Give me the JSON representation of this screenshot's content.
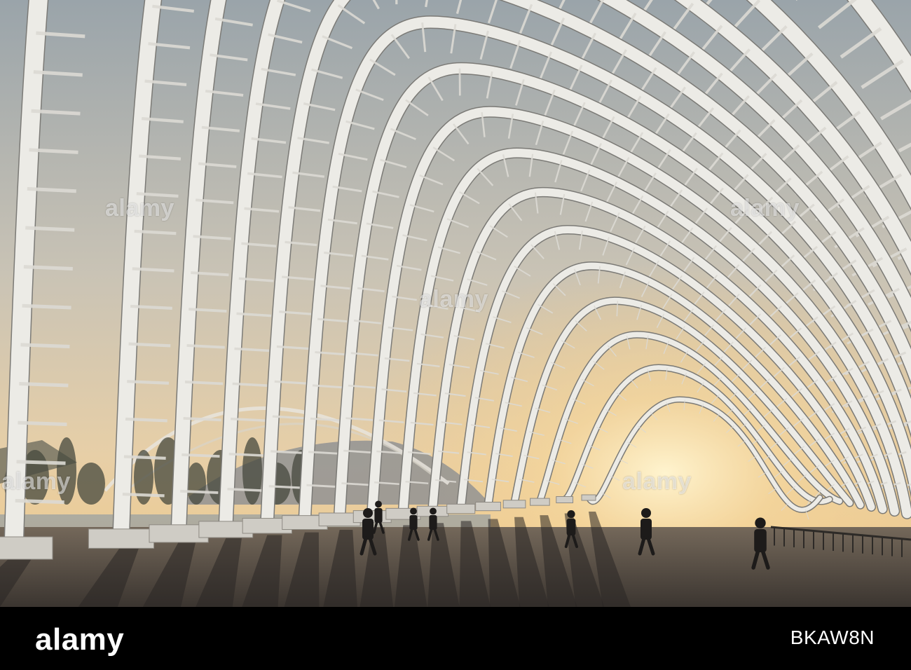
{
  "photo": {
    "subject": "silhouettes walking under white steel arches at sunset",
    "colors": {
      "sky_top": "#a7acb0",
      "sky_mid": "#d9c9b0",
      "sky_glow": "#f4cf8e",
      "ground": "#5d554c",
      "shadow": "#2a2724",
      "arch": "#e9e8e4",
      "arch_shade": "#8d8c88"
    }
  },
  "watermarks": {
    "left": "alamy",
    "center": "alamy",
    "top": "alamy",
    "top_right": "alamy",
    "right": "alamy"
  },
  "footer": {
    "brand": "alamy",
    "image_id": "BKAW8N"
  }
}
